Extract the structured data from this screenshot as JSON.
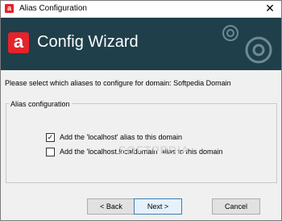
{
  "window": {
    "title": "Alias Configuration",
    "close_glyph": "✕"
  },
  "banner": {
    "logo_letter": "a",
    "title": "Config Wizard"
  },
  "prompt": "Please select which aliases to configure for domain: Softpedia Domain",
  "group": {
    "label": "Alias configuration",
    "options": [
      {
        "label": "Add the 'localhost' alias to this domain",
        "checked": true
      },
      {
        "label": "Add the 'localhost.localdomain' alias to this domain",
        "checked": false
      }
    ]
  },
  "watermark": "SOFTPEDIA",
  "buttons": {
    "back": "< Back",
    "next": "Next >",
    "cancel": "Cancel"
  },
  "colors": {
    "banner": "#1f3f4b",
    "accent": "#e4232b"
  },
  "icons": {
    "app": "avast-logo-icon",
    "gears": "gear-icon"
  }
}
